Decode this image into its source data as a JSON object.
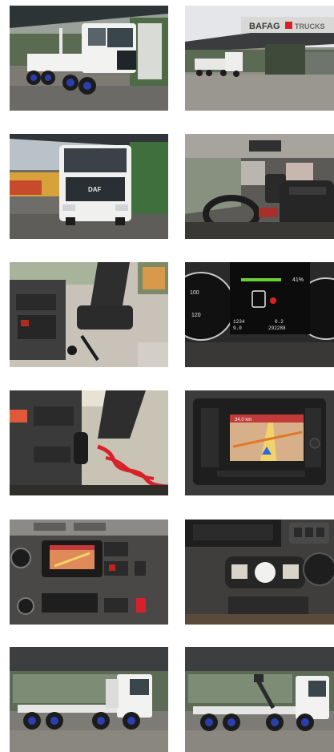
{
  "gallery": {
    "photos": [
      {
        "alt": "truck-front-three-quarter"
      },
      {
        "alt": "dealership-exterior"
      },
      {
        "alt": "truck-front"
      },
      {
        "alt": "cab-interior-steering"
      },
      {
        "alt": "cab-interior-center-console"
      },
      {
        "alt": "instrument-cluster"
      },
      {
        "alt": "cab-interior-gear-lever"
      },
      {
        "alt": "navigation-display"
      },
      {
        "alt": "dashboard-center-stack"
      },
      {
        "alt": "dashboard-switch-panel"
      },
      {
        "alt": "truck-side-left"
      },
      {
        "alt": "truck-side-right"
      }
    ],
    "dealer_sign": "BAFAG",
    "dealer_sign_suffix": "TRUCKS",
    "grille_badge": "DAF",
    "cluster": {
      "gauge_left_100": "100",
      "gauge_left_120": "120",
      "percent": "41%",
      "odometer": "1234",
      "trip": "9.0",
      "temp": "0.2",
      "total": "292288"
    },
    "nav_header": "34.0 km"
  },
  "colors": {
    "truck_white": "#f2f2f0",
    "wheel_blue": "#2a3fb0",
    "hall_green": "#3f6b3a",
    "cable_red": "#d8202a",
    "dash_dark": "#2b2a29",
    "nav_orange": "#e07a2a"
  }
}
